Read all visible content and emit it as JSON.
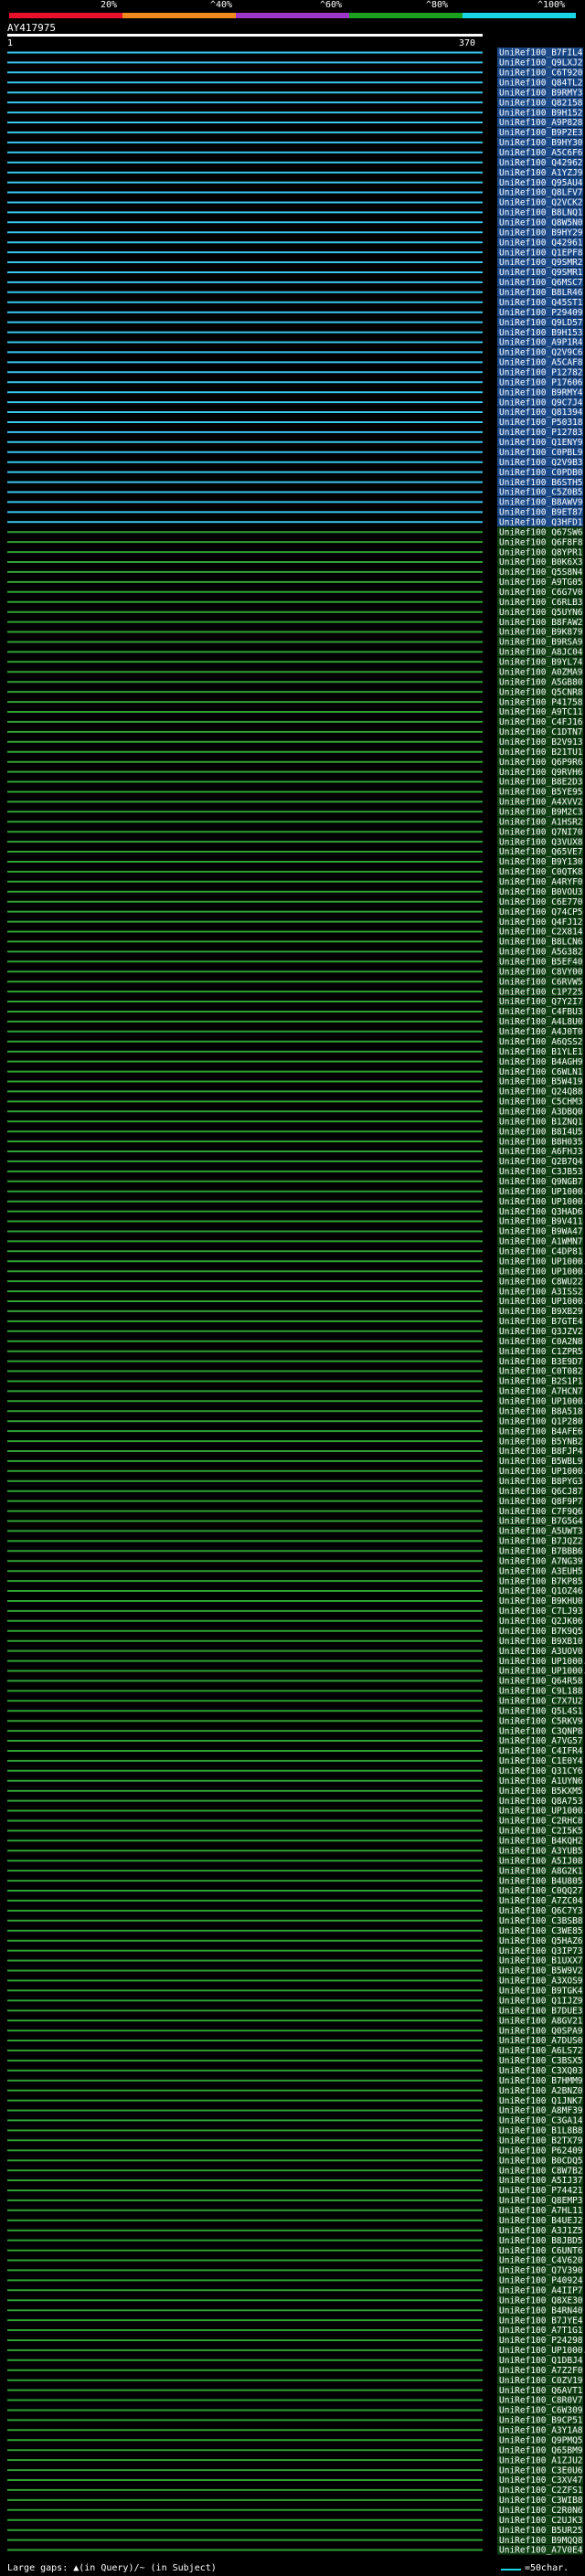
{
  "colors": {
    "seg1": "#e8102a",
    "seg2": "#f08a1c",
    "seg3": "#9d37c8",
    "seg4": "#1aa21f",
    "seg5": "#19d6e6",
    "hit_cyan": "#39c8f0",
    "hit_green": "#2fa234",
    "label_bg": "#ffffff"
  },
  "scale": [
    "20%",
    "^40%",
    "^60%",
    "^80%",
    "^100%"
  ],
  "query": {
    "id": "AY417975",
    "start": "1",
    "end": "370"
  },
  "footer": {
    "gaps_text": "Large gaps: ▲(in Query)/~ (in Subject)",
    "legend_text": "=50char."
  },
  "chart_data": {
    "type": "alignment",
    "x_range": [
      1,
      370
    ],
    "hits": [
      "UniRef100_B7FIL4",
      "UniRef100_Q9LXJ2",
      "UniRef100_C6T920",
      "UniRef100_Q84TL2",
      "UniRef100_B9RMY3",
      "UniRef100_Q82158",
      "UniRef100_B9H152",
      "UniRef100_A9P828",
      "UniRef100_B9P2E3",
      "UniRef100_B9HY30",
      "UniRef100_A5C6F6",
      "UniRef100_Q42962",
      "UniRef100_A1YZJ9",
      "UniRef100_Q95AU4",
      "UniRef100_Q8LFV7",
      "UniRef100_Q2VCK2",
      "UniRef100_B8LNQ1",
      "UniRef100_Q8W5N0",
      "UniRef100_B9HY29",
      "UniRef100_Q42961",
      "UniRef100_Q1EPF8",
      "UniRef100_Q9SMR2",
      "UniRef100_Q9SMR1",
      "UniRef100_Q6MSC7",
      "UniRef100_B8LR46",
      "UniRef100_Q45ST1",
      "UniRef100_P29409",
      "UniRef100_Q9LD57",
      "UniRef100_B9H153",
      "UniRef100_A9P1R4",
      "UniRef100_Q2V9C6",
      "UniRef100_A5CAF8",
      "UniRef100_P12782",
      "UniRef100_P17606",
      "UniRef100_B9RMY4",
      "UniRef100_Q9C7J4",
      "UniRef100_Q81394",
      "UniRef100_P50318",
      "UniRef100_P12783",
      "UniRef100_Q1ENY9",
      "UniRef100_C0PBL9",
      "UniRef100_Q2V9B3",
      "UniRef100_C0PDB0",
      "UniRef100_B6STH5",
      "UniRef100_C5Z0B5",
      "UniRef100_B8AWV9",
      "UniRef100_B9ET87",
      "UniRef100_Q3HFD1",
      "UniRef100_Q67SW6",
      "UniRef100_Q6F8F8",
      "UniRef100_Q8YPR1",
      "UniRef100_B0K6X3",
      "UniRef100_Q5S8N4",
      "UniRef100_A9TG05",
      "UniRef100_C6G7V0",
      "UniRef100_C6RLB3",
      "UniRef100_Q5UYN6",
      "UniRef100_B8FAW2",
      "UniRef100_B9K879",
      "UniRef100_B9RSA9",
      "UniRef100_A8JC04",
      "UniRef100_B9YL74",
      "UniRef100_A0ZMA9",
      "UniRef100_A5GB80",
      "UniRef100_Q5CNR8",
      "UniRef100_P41758",
      "UniRef100_A9TC11",
      "UniRef100_C4FJ16",
      "UniRef100_C1DTN7",
      "UniRef100_B2V913",
      "UniRef100_B21TU1",
      "UniRef100_Q6P9R6",
      "UniRef100_Q9RVH6",
      "UniRef100_B8E2D3",
      "UniRef100_B5YE95",
      "UniRef100_A4XVV2",
      "UniRef100_B9M2C3",
      "UniRef100_A1HSR2",
      "UniRef100_Q7NI70",
      "UniRef100_Q3VUX8",
      "UniRef100_Q65VE7",
      "UniRef100_B9Y130",
      "UniRef100_C0QTK8",
      "UniRef100_A4RYF0",
      "UniRef100_B0VOU3",
      "UniRef100_C6E770",
      "UniRef100_Q74CP5",
      "UniRef100_Q4FJ12",
      "UniRef100_C2X814",
      "UniRef100_B8LCN6",
      "UniRef100_A5G382",
      "UniRef100_B5EF40",
      "UniRef100_C8VY00",
      "UniRef100_C6RVW5",
      "UniRef100_C1P725",
      "UniRef100_Q7Y2I7",
      "UniRef100_C4FBU3",
      "UniRef100_A4L8U0",
      "UniRef100_A4J0T0",
      "UniRef100_A6QSS2",
      "UniRef100_B1YLE1",
      "UniRef100_B4AGH9",
      "UniRef100_C6WLN1",
      "UniRef100_B5W419",
      "UniRef100_Q24Q88",
      "UniRef100_C5CHM3",
      "UniRef100_A3DBQ0",
      "UniRef100_B1ZNQ1",
      "UniRef100_B8I4U5",
      "UniRef100_B8H035",
      "UniRef100_A6FHJ3",
      "UniRef100_Q2B7Q4",
      "UniRef100_C3JB53",
      "UniRef100_Q9NGB7",
      "UniRef100_UP1000...",
      "UniRef100_UP1000...",
      "UniRef100_Q3HAD6",
      "UniRef100_B9V411",
      "UniRef100_B9WA47",
      "UniRef100_A1WMN7",
      "UniRef100_C4DP81",
      "UniRef100_UP1000...",
      "UniRef100_UP1000...",
      "UniRef100_C8WU22",
      "UniRef100_A3ISS2",
      "UniRef100_UP1000...",
      "UniRef100_B9XB29",
      "UniRef100_B7GTE4",
      "UniRef100_Q3JZV2",
      "UniRef100_C0A2N8",
      "UniRef100_C1ZPR5",
      "UniRef100_B3E9D7",
      "UniRef100_C0T082",
      "UniRef100_B2S1P1",
      "UniRef100_A7HCN7",
      "UniRef100_UP1000...",
      "UniRef100_B8A518",
      "UniRef100_Q1P280",
      "UniRef100_B4AFE6",
      "UniRef100_B5YNB2",
      "UniRef100_B8FJP4",
      "UniRef100_B5WBL9",
      "UniRef100_UP1000...",
      "UniRef100_B8PYG3",
      "UniRef100_Q6CJ87",
      "UniRef100_Q8F9P7",
      "UniRef100_C7F9Q6",
      "UniRef100_B7G5G4",
      "UniRef100_A5UWT3",
      "UniRef100_B7JQZ2",
      "UniRef100_B7BBB6",
      "UniRef100_A7NG39",
      "UniRef100_A3EUH5",
      "UniRef100_B7KP85",
      "UniRef100_Q1OZ46",
      "UniRef100_B9KHU0",
      "UniRef100_C7LJ93",
      "UniRef100_Q2JK06",
      "UniRef100_B7K9Q5",
      "UniRef100_B9XB10",
      "UniRef100_A3UOV0",
      "UniRef100_UP1000...",
      "UniRef100_UP1000...",
      "UniRef100_Q64R58",
      "UniRef100_C9L188",
      "UniRef100_C7X7U2",
      "UniRef100_Q5L4S1",
      "UniRef100_C5RKV9",
      "UniRef100_C3QNP8",
      "UniRef100_A7VG57",
      "UniRef100_C4IFR4",
      "UniRef100_C1E0Y4",
      "UniRef100_Q31CY6",
      "UniRef100_A1UYN6",
      "UniRef100_B5KXM5",
      "UniRef100_Q8A753",
      "UniRef100_UP1000...",
      "UniRef100_C2RHC8",
      "UniRef100_C2I5K5",
      "UniRef100_B4KQH2",
      "UniRef100_A3YUB5",
      "UniRef100_A5IJ08",
      "UniRef100_A8G2K1",
      "UniRef100_B4U805",
      "UniRef100_C0QQ27",
      "UniRef100_A7ZC04",
      "UniRef100_Q6C7Y3",
      "UniRef100_C3BSB8",
      "UniRef100_C3WE85",
      "UniRef100_Q5HAZ6",
      "UniRef100_Q3IP73",
      "UniRef100_B1UXX7",
      "UniRef100_B5W9V2",
      "UniRef100_A3XOS9",
      "UniRef100_B9TGK4",
      "UniRef100_Q1IJZ9",
      "UniRef100_B7DUE3",
      "UniRef100_A8GV21",
      "UniRef100_Q0SPA9",
      "UniRef100_A7DUS0",
      "UniRef100_A6LS72",
      "UniRef100_C3BSX5",
      "UniRef100_C3XQ03",
      "UniRef100_B7HMM9",
      "UniRef100_A2BNZ0",
      "UniRef100_Q1JNK7",
      "UniRef100_A8MF39",
      "UniRef100_C3GA14",
      "UniRef100_B1L8B8",
      "UniRef100_B2TX79",
      "UniRef100_P62409",
      "UniRef100_B0CDQ5",
      "UniRef100_C8W7B2",
      "UniRef100_A5IJ37",
      "UniRef100_P74421",
      "UniRef100_Q8EMP3",
      "UniRef100_A7HL11",
      "UniRef100_B4UEJ2",
      "UniRef100_A3J1Z5",
      "UniRef100_B8JBD5",
      "UniRef100_C6UNT6",
      "UniRef100_C4V620",
      "UniRef100_Q7V390",
      "UniRef100_P40924",
      "UniRef100_A4IIP7",
      "UniRef100_Q8XE30",
      "UniRef100_B4RN40",
      "UniRef100_B7JYE4",
      "UniRef100_A7T1G1",
      "UniRef100_P24298",
      "UniRef100_UP1000...",
      "UniRef100_Q1DBJ4",
      "UniRef100_A7Z2F0",
      "UniRef100_C0ZV19",
      "UniRef100_Q6AVT1",
      "UniRef100_C8R0V7",
      "UniRef100_C6W309",
      "UniRef100_B9CP51",
      "UniRef100_A3Y1A8",
      "UniRef100_Q9PMQ5",
      "UniRef100_Q65BM9",
      "UniRef100_A1ZJU2",
      "UniRef100_C3E0U6",
      "UniRef100_C3XV47",
      "UniRef100_C2ZFS1",
      "UniRef100_C3WIB8",
      "UniRef100_C2R0N6",
      "UniRef100_C2UJK3",
      "UniRef100_B5UR25",
      "UniRef100_B9MQQ8",
      "UniRef100_A7V0E4"
    ]
  }
}
